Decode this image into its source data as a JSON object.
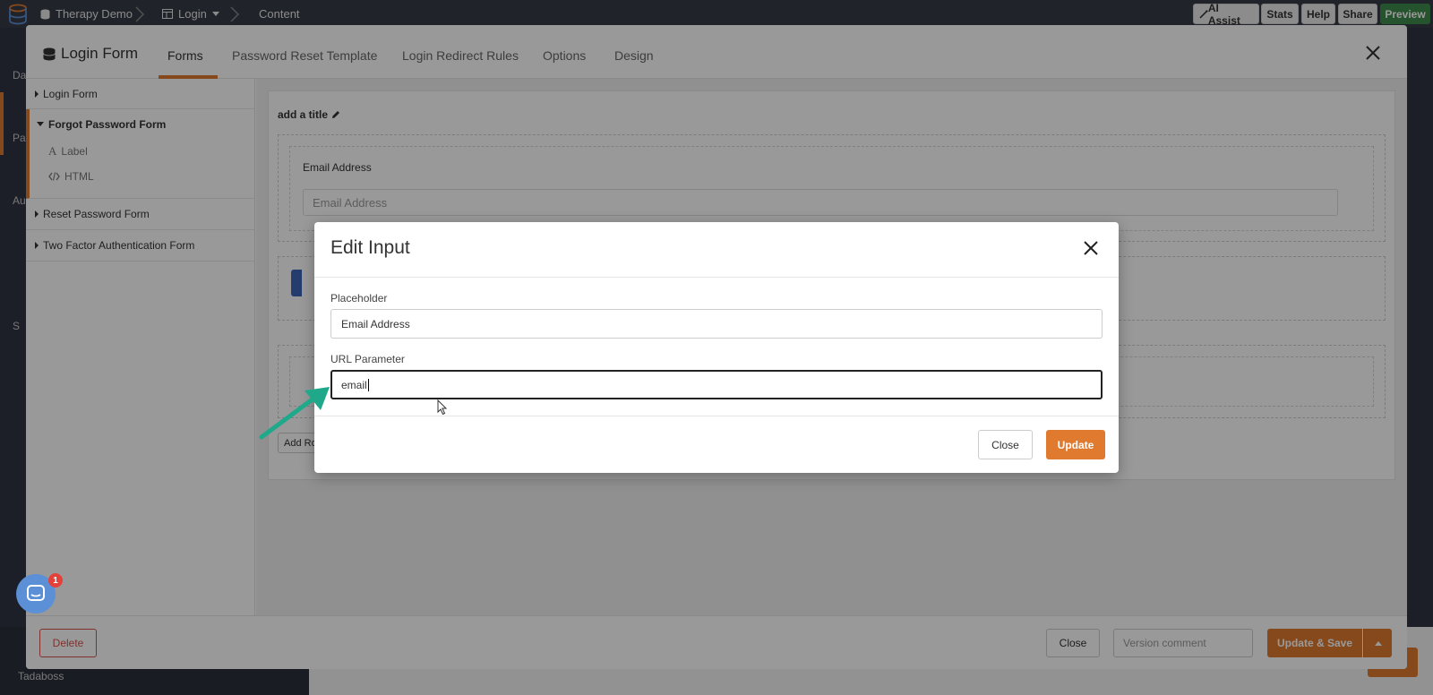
{
  "topbar": {
    "app_name": "Therapy Demo",
    "page_name": "Login",
    "section_name": "Content",
    "buttons": {
      "ai_assist": "AI Assist",
      "stats": "Stats",
      "help": "Help",
      "share": "Share",
      "preview": "Preview"
    }
  },
  "background": {
    "sidebar_labels": [
      "Da",
      "Pa",
      "Au",
      "S"
    ],
    "footer_label": "Tadaboss"
  },
  "form_modal": {
    "title": "Login Form",
    "tabs": [
      {
        "label": "Forms",
        "active": true
      },
      {
        "label": "Password Reset Template",
        "active": false
      },
      {
        "label": "Login Redirect Rules",
        "active": false
      },
      {
        "label": "Options",
        "active": false
      },
      {
        "label": "Design",
        "active": false
      }
    ],
    "sidebar": {
      "items": [
        {
          "label": "Login Form"
        },
        {
          "label": "Forgot Password Form",
          "children": [
            {
              "label": "Label",
              "icon": "font-icon"
            },
            {
              "label": "HTML",
              "icon": "code-icon"
            }
          ]
        },
        {
          "label": "Reset Password Form"
        },
        {
          "label": "Two Factor Authentication Form"
        }
      ]
    },
    "content": {
      "add_title": "add a title",
      "field_label": "Email Address",
      "field_placeholder": "Email Address",
      "add_row_label": "Add Ro"
    },
    "footer": {
      "delete_label": "Delete",
      "close_label": "Close",
      "version_placeholder": "Version comment",
      "update_save_label": "Update & Save"
    }
  },
  "edit_dialog": {
    "title": "Edit Input",
    "placeholder_label": "Placeholder",
    "placeholder_value": "Email Address",
    "url_param_label": "URL Parameter",
    "url_param_value": "email",
    "close_label": "Close",
    "update_label": "Update"
  },
  "chat": {
    "badge_count": "1"
  },
  "colors": {
    "accent": "#e07a2f",
    "preview_green": "#3e8a4e",
    "arrow_teal": "#1fa98a",
    "chat_blue": "#5b8fd6",
    "badge_red": "#e5413b"
  }
}
